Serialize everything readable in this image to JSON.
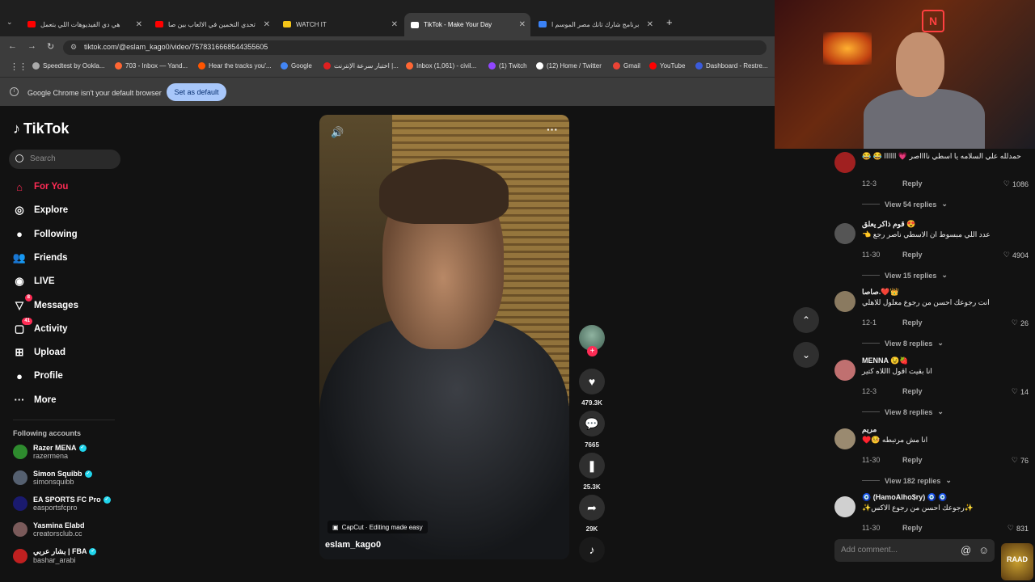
{
  "browser": {
    "tabs": [
      {
        "title": "هي دي الفيديوهات اللي بتعمل",
        "favicon_color": "#ff0000"
      },
      {
        "title": "تحدي التخمين في الالعاب بين صا",
        "favicon_color": "#ff0000"
      },
      {
        "title": "WATCH IT",
        "favicon_color": "#f5c518"
      },
      {
        "title": "TikTok - Make Your Day",
        "favicon_color": "#ffffff",
        "active": true
      },
      {
        "title": "برنامج شارك تانك مصر الموسم ا",
        "favicon_color": "#3b82f6"
      }
    ],
    "new_tab": "+",
    "url": "tiktok.com/@eslam_kago0/video/7578316668544355605",
    "bookmarks": [
      {
        "label": "Speedtest by Ookla...",
        "color": "#aaaaaa"
      },
      {
        "label": "703 - Inbox — Yand...",
        "color": "#ff6633"
      },
      {
        "label": "Hear the tracks you'...",
        "color": "#ff5500"
      },
      {
        "label": "Google",
        "color": "#4285f4"
      },
      {
        "label": "اختبار سرعة الإنترنت |...",
        "color": "#e02020"
      },
      {
        "label": "Inbox (1,061) - civil...",
        "color": "#ff6633"
      },
      {
        "label": "(1) Twitch",
        "color": "#9146ff"
      },
      {
        "label": "(12) Home / Twitter",
        "color": "#ffffff"
      },
      {
        "label": "Gmail",
        "color": "#ea4335"
      },
      {
        "label": "YouTube",
        "color": "#ff0000"
      },
      {
        "label": "Dashboard - Restre...",
        "color": "#3b5bdb"
      }
    ],
    "infobar": {
      "message": "Google Chrome isn't your default browser",
      "button": "Set as default"
    }
  },
  "sidebar": {
    "logo": "TikTok",
    "search_placeholder": "Search",
    "nav": [
      {
        "label": "For You",
        "icon": "home-icon",
        "active": true
      },
      {
        "label": "Explore",
        "icon": "compass-icon"
      },
      {
        "label": "Following",
        "icon": "following-avatar-icon"
      },
      {
        "label": "Friends",
        "icon": "friends-icon"
      },
      {
        "label": "LIVE",
        "icon": "live-icon"
      },
      {
        "label": "Messages",
        "icon": "messages-icon",
        "badge": "8"
      },
      {
        "label": "Activity",
        "icon": "activity-icon",
        "badge": "41"
      },
      {
        "label": "Upload",
        "icon": "upload-icon"
      },
      {
        "label": "Profile",
        "icon": "profile-icon"
      },
      {
        "label": "More",
        "icon": "more-icon"
      }
    ],
    "following_title": "Following accounts",
    "accounts": [
      {
        "name": "Razer MENA",
        "handle": "razermena",
        "verified": true,
        "color": "#2e8b2e"
      },
      {
        "name": "Simon Squibb",
        "handle": "simonsquibb",
        "verified": true,
        "color": "#556070"
      },
      {
        "name": "EA SPORTS FC Pro",
        "handle": "easportsfcpro",
        "verified": true,
        "color": "#1a1a6e"
      },
      {
        "name": "Yasmina Elabd",
        "handle": "creatorsclub.cc",
        "verified": false,
        "color": "#7a5a5a"
      },
      {
        "name": "بشار عربي | FBA",
        "handle": "bashar_arabi",
        "verified": true,
        "color": "#c02020"
      }
    ]
  },
  "video": {
    "author": "eslam_kago0",
    "capcut": "CapCut · Editing made easy",
    "likes": "479.3K",
    "comments": "7665",
    "saves": "25.3K",
    "shares": "29K"
  },
  "comments": [
    {
      "name": "",
      "text": "حمدلله علي السلامه يا اسطي نااااصر 💗 اااااا 😂 😂",
      "date": "12-3",
      "reply": "Reply",
      "likes": "1086",
      "view": "View 54 replies",
      "avatar_color": "#a02020"
    },
    {
      "name": "قوم ذاكر يعلق 😍",
      "text": "عدد اللي مبسوط ان الاسطي ناصر رجع 👈",
      "date": "11-30",
      "reply": "Reply",
      "likes": "4904",
      "view": "View 15 replies",
      "avatar_color": "#555555"
    },
    {
      "name": "صاصا.❤️👑",
      "text": "انت رجوعك احسن من رجوع معلول للاهلي",
      "date": "12-1",
      "reply": "Reply",
      "likes": "26",
      "view": "View 8 replies",
      "avatar_color": "#8a7a60"
    },
    {
      "name": "MENNA 😉🍓",
      "text": "انا بقيت اقول االلاه كتير",
      "date": "12-3",
      "reply": "Reply",
      "likes": "14",
      "view": "View 8 replies",
      "avatar_color": "#c07070"
    },
    {
      "name": "مريم",
      "text": "انا مش مرتبطه 🤒♥️",
      "date": "11-30",
      "reply": "Reply",
      "likes": "76",
      "view": "View 182 replies",
      "avatar_color": "#9a8a70"
    },
    {
      "name": "🧿 (HamoAlho$ry) 🧿 🧿",
      "text": "✨رجوعك احسن من رجوع الاكس✨",
      "date": "11-30",
      "reply": "Reply",
      "likes": "831",
      "view": "",
      "avatar_color": "#d0d0d0"
    }
  ],
  "add_comment_placeholder": "Add comment...",
  "webcam": {
    "logo_glyph": "N"
  },
  "corner_logo": "RAAD"
}
